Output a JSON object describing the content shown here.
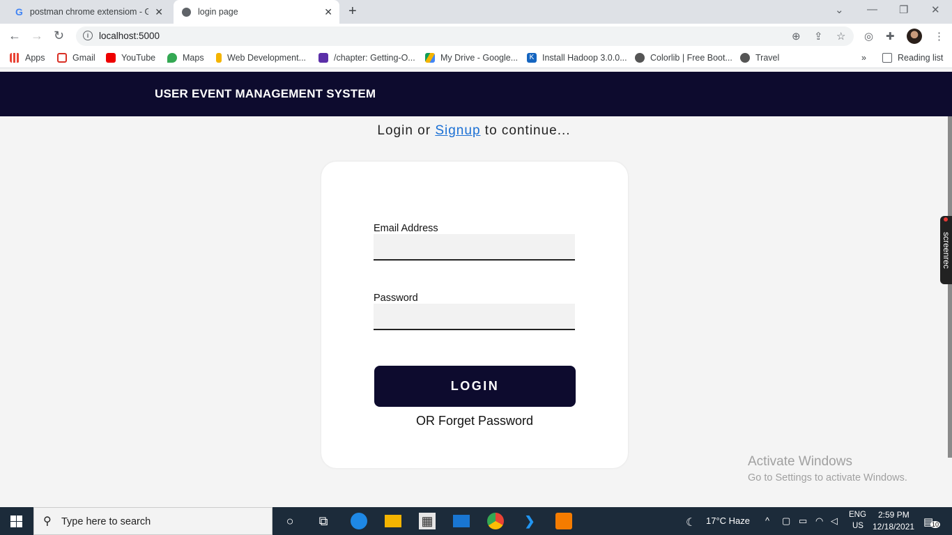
{
  "browser": {
    "tabs": [
      {
        "title": "postman chrome extensiom - Go",
        "favicon": "google-g",
        "close": "✕"
      },
      {
        "title": "login page",
        "favicon": "globe",
        "close": "✕"
      }
    ],
    "new_tab": "+",
    "address": "localhost:5000",
    "bookmarks": [
      {
        "label": "Apps",
        "icon": "apps-grid"
      },
      {
        "label": "Gmail",
        "icon": "gmail"
      },
      {
        "label": "YouTube",
        "icon": "youtube"
      },
      {
        "label": "Maps",
        "icon": "maps-pin"
      },
      {
        "label": "Web Development...",
        "icon": "folder"
      },
      {
        "label": "/chapter: Getting-O...",
        "icon": "purple-logo"
      },
      {
        "label": "My Drive - Google...",
        "icon": "google-drive"
      },
      {
        "label": "Install Hadoop 3.0.0...",
        "icon": "k-logo"
      },
      {
        "label": "Colorlib | Free Boot...",
        "icon": "globe"
      },
      {
        "label": "Travel",
        "icon": "globe"
      }
    ],
    "more_bookmarks": "»",
    "reading_list": "Reading list"
  },
  "page": {
    "brand": "USER EVENT MANAGEMENT SYSTEM",
    "heading_prefix": "Login or ",
    "heading_link": "Signup",
    "heading_suffix": " to continue...",
    "form": {
      "email_label": "Email Address",
      "email_value": "",
      "password_label": "Password",
      "password_value": "",
      "login_button": "LOGIN",
      "forget_text": "OR Forget Password"
    },
    "watermark": {
      "line1": "Activate Windows",
      "line2": "Go to Settings to activate Windows."
    },
    "screenrec": "screenrec"
  },
  "taskbar": {
    "search_placeholder": "Type here to search",
    "weather": "17°C  Haze",
    "lang_top": "ENG",
    "lang_bottom": "US",
    "time": "2:59 PM",
    "date": "12/18/2021",
    "notifications": "10"
  }
}
